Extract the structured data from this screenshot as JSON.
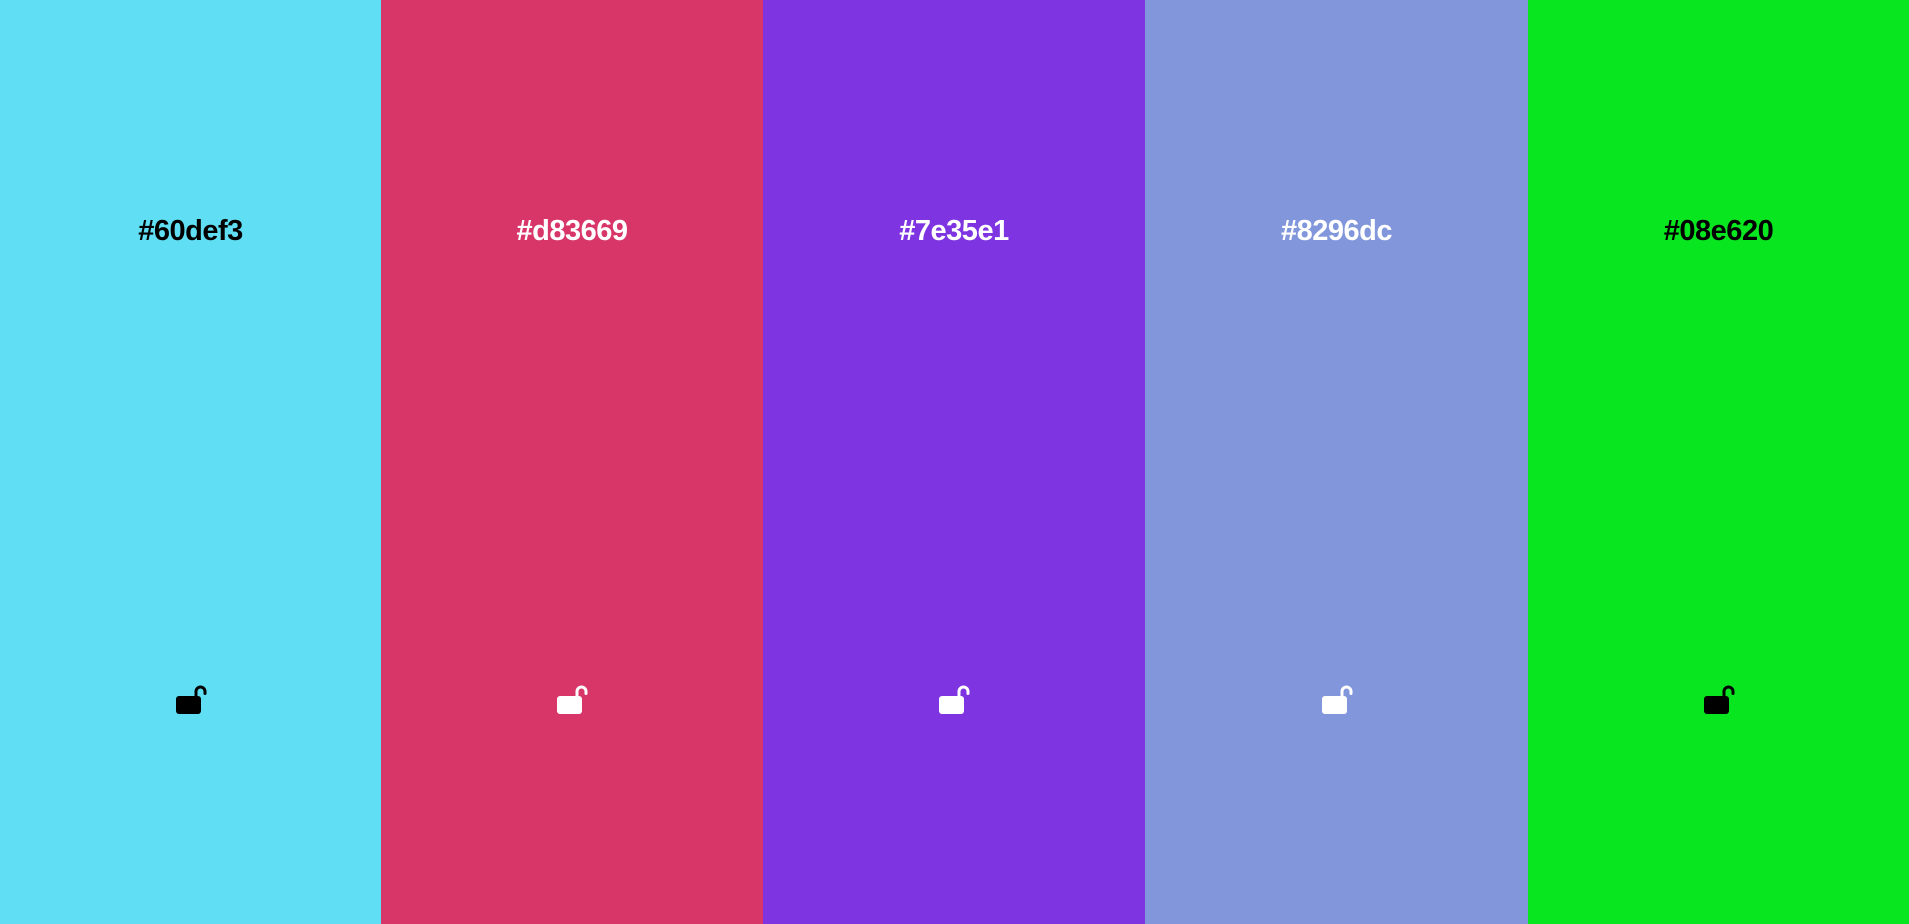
{
  "palette": {
    "swatches": [
      {
        "hex": "#60def3",
        "color": "#60def3",
        "text_color": "#000000",
        "lock_icon": "unlocked-padlock-icon",
        "locked": false
      },
      {
        "hex": "#d83669",
        "color": "#d83669",
        "text_color": "#ffffff",
        "lock_icon": "unlocked-padlock-icon",
        "locked": false
      },
      {
        "hex": "#7e35e1",
        "color": "#7e35e1",
        "text_color": "#ffffff",
        "lock_icon": "unlocked-padlock-icon",
        "locked": false
      },
      {
        "hex": "#8296dc",
        "color": "#8296dc",
        "text_color": "#ffffff",
        "lock_icon": "unlocked-padlock-icon",
        "locked": false
      },
      {
        "hex": "#08e620",
        "color": "#08e620",
        "text_color": "#000000",
        "lock_icon": "unlocked-padlock-icon",
        "locked": false
      }
    ]
  }
}
